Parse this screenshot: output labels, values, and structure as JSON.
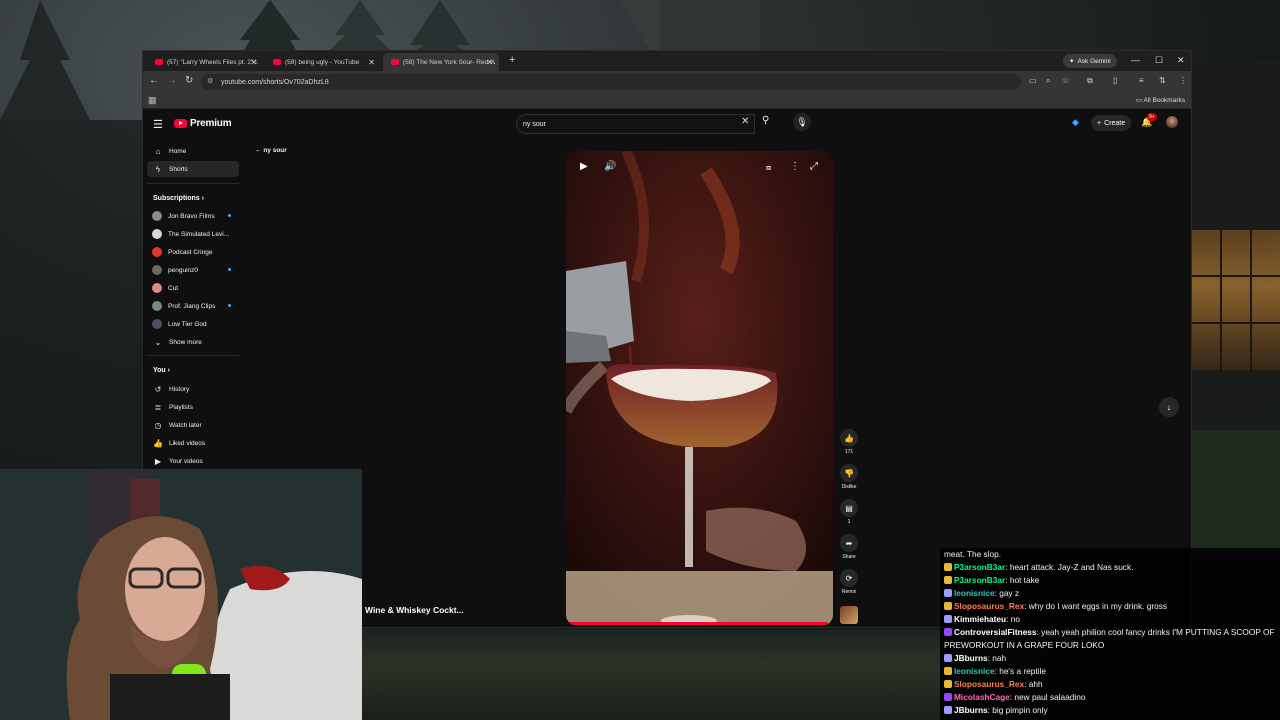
{
  "browser": {
    "tabs": [
      {
        "label": "(57) \"Larry Wheels Files pt. 2\" I...",
        "active": false
      },
      {
        "label": "(58) being ugly - YouTube",
        "active": false
      },
      {
        "label": "(58) The New York Sour- Red W...",
        "active": true
      }
    ],
    "gemini_label": "Ask Gemini",
    "url": "youtube.com/shorts/Ov702aDhzL8",
    "all_bookmarks": "All Bookmarks"
  },
  "youtube": {
    "logo_text": "Premium",
    "search_query": "ny sour",
    "create_label": "Create",
    "notification_count": "9+",
    "back_label": "ny sour"
  },
  "sidebar": {
    "main": [
      {
        "label": "Home",
        "icon": "home-icon"
      },
      {
        "label": "Shorts",
        "icon": "shorts-icon",
        "active": true
      }
    ],
    "subscriptions_title": "Subscriptions",
    "subscriptions": [
      {
        "label": "Jon Bravo Films",
        "new": true,
        "color": "#8a8a8a"
      },
      {
        "label": "The Simulated Levi...",
        "new": false,
        "color": "#d8d8d8"
      },
      {
        "label": "Podcast Cringe",
        "new": false,
        "color": "#e0392b"
      },
      {
        "label": "penguinz0",
        "new": true,
        "color": "#6a6a5a"
      },
      {
        "label": "Cut",
        "new": false,
        "color": "#e28a78"
      },
      {
        "label": "Prof. Jiang Clips",
        "new": true,
        "color": "#7a8a7a"
      },
      {
        "label": "Low Tier God",
        "new": false,
        "color": "#5a4a6a"
      }
    ],
    "show_more": "Show more",
    "you_title": "You",
    "you": [
      {
        "label": "History",
        "icon": "history-icon"
      },
      {
        "label": "Playlists",
        "icon": "playlists-icon"
      },
      {
        "label": "Watch later",
        "icon": "watch-later-icon"
      },
      {
        "label": "Liked videos",
        "icon": "liked-icon"
      },
      {
        "label": "Your videos",
        "icon": "your-videos-icon"
      }
    ]
  },
  "short": {
    "likes": "171",
    "dislike_label": "Dislike",
    "comments": "1",
    "share_label": "Share",
    "remix_label": "Remix",
    "channel_title": "Wine & Whiskey Cockt...",
    "progress": 0.98
  },
  "chat": [
    {
      "user": "",
      "text": "meat. The slop.",
      "color": "#ffffff"
    },
    {
      "user": "P3arsonB3ar",
      "text": "heart attack. Jay-Z and Nas suck.",
      "color": "#00ff7f",
      "badge": "#e8b833"
    },
    {
      "user": "P3arsonB3ar",
      "text": "hot take",
      "color": "#00ff7f",
      "badge": "#e8b833"
    },
    {
      "user": "leonisnice",
      "text": "gay z",
      "color": "#39c7b0",
      "badge": "#9a9cff"
    },
    {
      "user": "Sloposaurus_Rex",
      "text": "why do I want eggs in my drink. gross",
      "color": "#ff7f50",
      "badge": "#e8b833"
    },
    {
      "user": "Kimmiehateu",
      "text": "no",
      "color": "#ffffff",
      "badge": "#9a9cff"
    },
    {
      "user": "ControversialFitness",
      "text": "yeah yeah philion cool fancy drinks I'M PUTTING A SCOOP OF PREWORKOUT IN A GRAPE FOUR LOKO",
      "color": "#ffffff",
      "badge": "#9146ff"
    },
    {
      "user": "JBburns",
      "text": "nah",
      "color": "#ffffff",
      "badge": "#9a9cff"
    },
    {
      "user": "leonisnice",
      "text": "he's a reptile",
      "color": "#39c7b0",
      "badge": "#e8b833"
    },
    {
      "user": "Sloposaurus_Rex",
      "text": "ahh",
      "color": "#ff7f50",
      "badge": "#e8b833"
    },
    {
      "user": "MicolashCage",
      "text": "new paul salaadino",
      "color": "#ff69b4",
      "badge": "#9146ff"
    },
    {
      "user": "JBburns",
      "text": "big pimpin only",
      "color": "#ffffff",
      "badge": "#9a9cff"
    }
  ]
}
